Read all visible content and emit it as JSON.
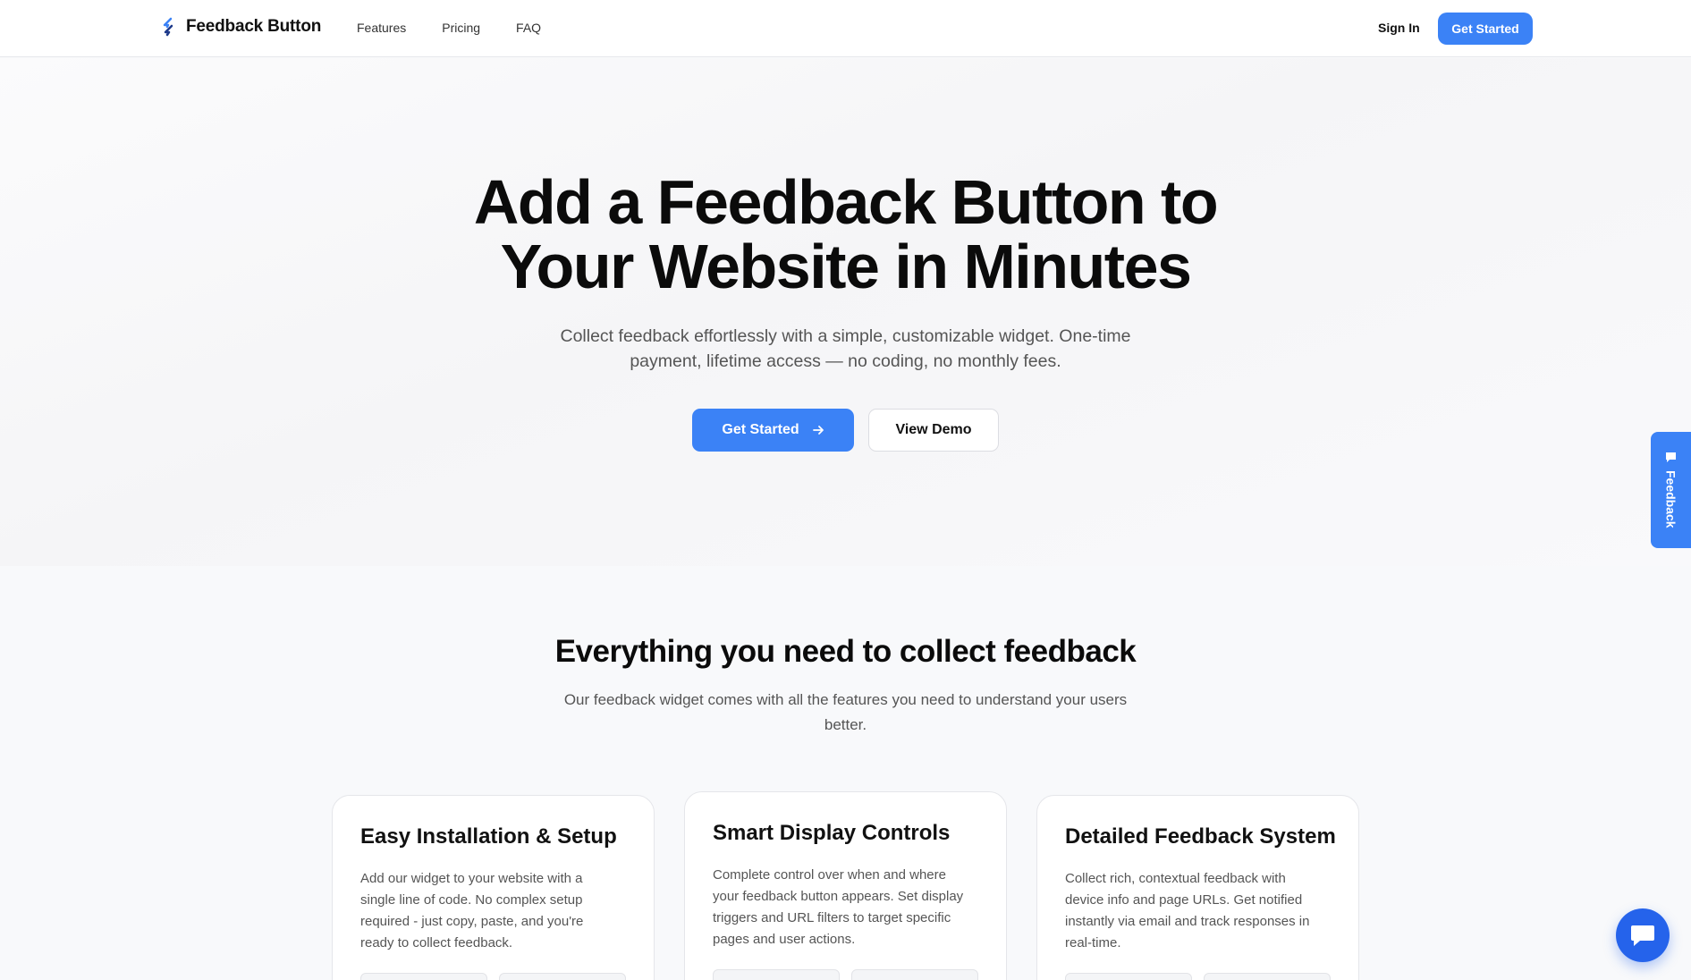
{
  "nav": {
    "brand": "Feedback Button",
    "links": [
      "Features",
      "Pricing",
      "FAQ"
    ],
    "sign_in": "Sign In",
    "cta": "Get Started"
  },
  "hero": {
    "title_line1": "Add a Feedback Button to",
    "title_line2": "Your Website in Minutes",
    "subtitle": "Collect feedback effortlessly with a simple, customizable widget. One-time payment, lifetime access — no coding, no monthly fees.",
    "primary_cta": "Get Started",
    "secondary_cta": "View Demo"
  },
  "features": {
    "title": "Everything you need to collect feedback",
    "subtitle": "Our feedback widget comes with all the features you need to understand your users better.",
    "cards": [
      {
        "title": "Easy Installation & Setup",
        "description": "Add our widget to your website with a single line of code. No complex setup required - just copy, paste, and you're ready to collect feedback."
      },
      {
        "title": "Smart Display Controls",
        "description": "Complete control over when and where your feedback button appears. Set display triggers and URL filters to target specific pages and user actions."
      },
      {
        "title": "Detailed Feedback System",
        "description": "Collect rich, contextual feedback with device info and page URLs. Get notified instantly via email and track responses in real-time."
      }
    ]
  },
  "widget": {
    "tab_label": "Feedback"
  },
  "colors": {
    "accent": "#3b82f6",
    "chat_bubble": "#2563eb"
  },
  "icons": [
    "logo-bolt-icon",
    "arrow-right-icon",
    "message-icon",
    "chat-bubble-icon"
  ]
}
